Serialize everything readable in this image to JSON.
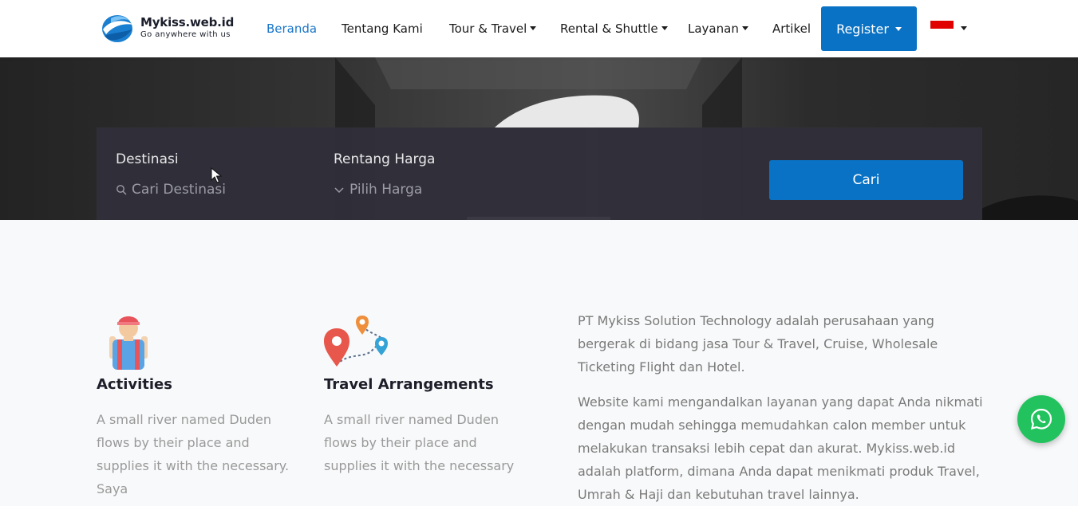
{
  "brand": {
    "name": "Mykiss.web.id",
    "tagline": "Go anywhere with us"
  },
  "nav": {
    "items": [
      {
        "label": "Beranda",
        "active": true,
        "dropdown": false
      },
      {
        "label": "Tentang Kami",
        "active": false,
        "dropdown": false
      },
      {
        "label": "Tour & Travel",
        "active": false,
        "dropdown": true
      },
      {
        "label": "Rental & Shuttle",
        "active": false,
        "dropdown": true
      },
      {
        "label": "Layanan",
        "active": false,
        "dropdown": true
      },
      {
        "label": "Artikel",
        "active": false,
        "dropdown": false
      }
    ],
    "register_label": "Register",
    "language_flag": "indonesia-flag-icon"
  },
  "search": {
    "destination_label": "Destinasi",
    "destination_placeholder": "Cari Destinasi",
    "price_label": "Rentang Harga",
    "price_placeholder": "Pilih Harga",
    "submit_label": "Cari"
  },
  "features": [
    {
      "icon": "traveler-icon",
      "title": "Activities",
      "text": "A small river named Duden flows by their place and supplies it with the necessary. Saya"
    },
    {
      "icon": "map-route-icon",
      "title": "Travel Arrangements",
      "text": "A small river named Duden flows by their place and supplies it with the necessary"
    }
  ],
  "about": {
    "paragraphs": [
      "PT Mykiss Solution Technology adalah perusahaan yang bergerak di bidang jasa Tour & Travel, Cruise, Wholesale Ticketing Flight dan Hotel.",
      "Website kami mengandalkan layanan yang dapat Anda nikmati dengan mudah sehingga memudahkan calon member untuk melakukan transaksi lebih cepat dan akurat. Mykiss.web.id adalah platform, dimana Anda dapat menikmati produk Travel, Umrah & Haji dan kebutuhan travel lainnya."
    ]
  },
  "floating": {
    "whatsapp_icon": "whatsapp-icon"
  },
  "colors": {
    "primary": "#0a72c4",
    "active_nav": "#1976c8",
    "whatsapp": "#22c35e",
    "search_panel": "#302f3a"
  }
}
